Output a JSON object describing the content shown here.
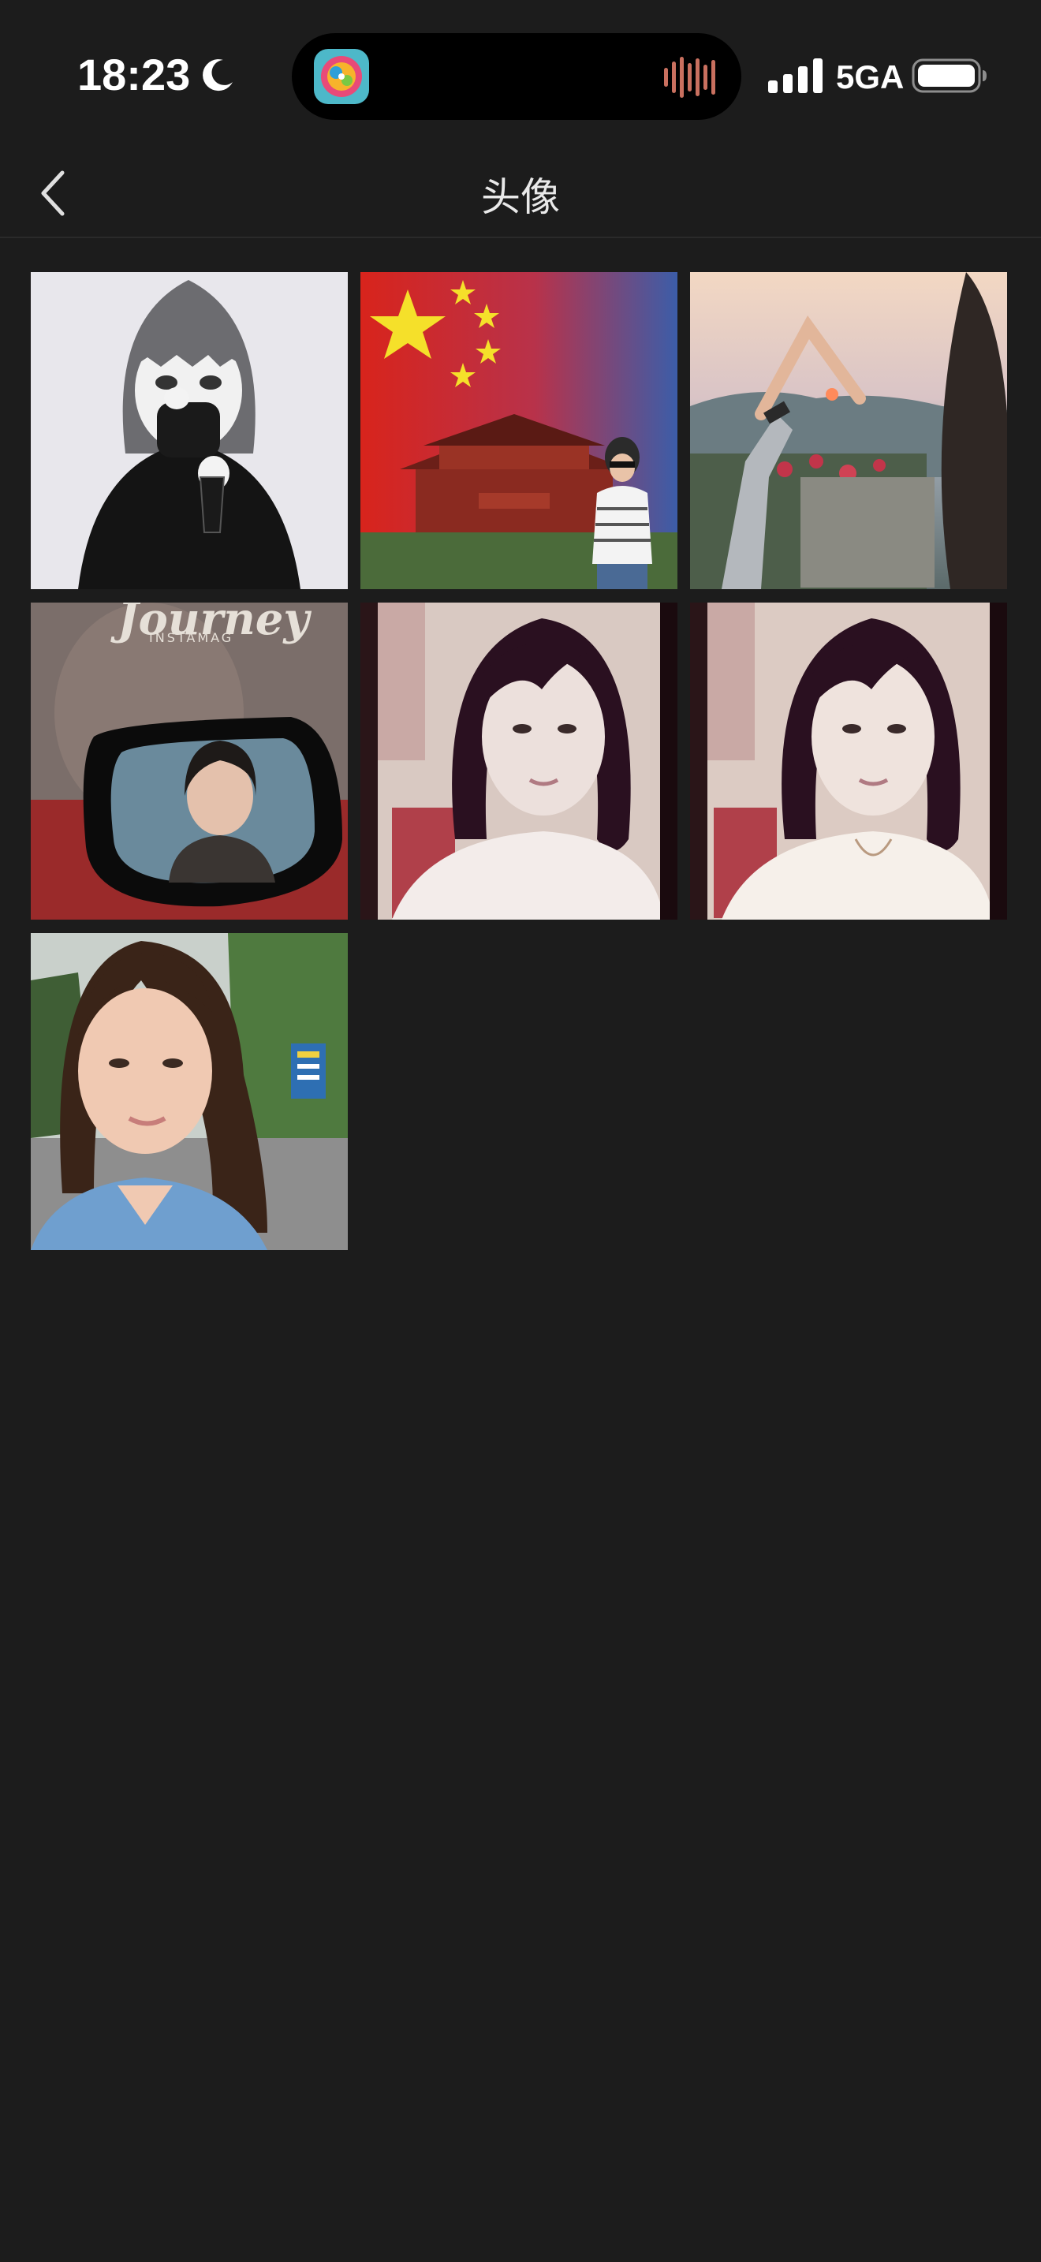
{
  "status_bar": {
    "time": "18:23",
    "focus_icon": "moon-icon",
    "network": "5GA",
    "signal_icon": "cellular-signal-icon",
    "battery_icon": "battery-icon",
    "island_app_icon": "app-icon",
    "island_activity_icon": "audio-waveform-icon"
  },
  "nav": {
    "back_icon": "chevron-left-icon",
    "title": "头像"
  },
  "photos": [
    {
      "id": "avatar-1",
      "subject": "illustration"
    },
    {
      "id": "avatar-2",
      "subject": "flag"
    },
    {
      "id": "avatar-3",
      "subject": "sunset"
    },
    {
      "id": "avatar-4",
      "subject": "mirror",
      "overlay_text": "Journey",
      "overlay_subtext": "INSTAMAG"
    },
    {
      "id": "avatar-5",
      "subject": "portrait"
    },
    {
      "id": "avatar-6",
      "subject": "portrait"
    },
    {
      "id": "avatar-7",
      "subject": "portrait-outdoor"
    }
  ],
  "colors": {
    "background": "#1c1c1c",
    "text": "#ffffff",
    "title": "#e9e9e9"
  }
}
